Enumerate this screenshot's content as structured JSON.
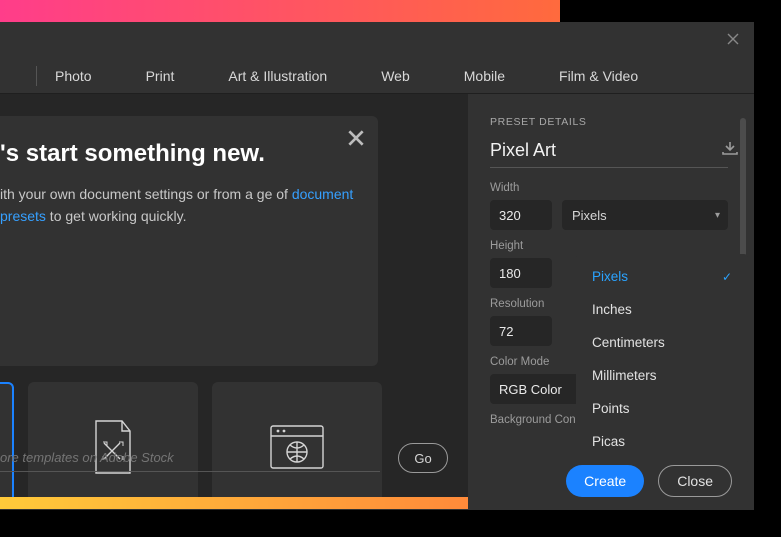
{
  "tabs": [
    "Photo",
    "Print",
    "Art & Illustration",
    "Web",
    "Mobile",
    "Film & Video"
  ],
  "welcome": {
    "title": "'s start something new.",
    "body_pre": "ith your own document settings or from a ge of ",
    "link": "document presets",
    "body_post": " to get working quickly."
  },
  "stock": {
    "placeholder": "ore templates on Adobe Stock",
    "go": "Go"
  },
  "side": {
    "header": "PRESET DETAILS",
    "preset_name": "Pixel Art",
    "labels": {
      "width": "Width",
      "height": "Height",
      "resolution": "Resolution",
      "color_mode": "Color Mode",
      "bg": "Background Con"
    },
    "values": {
      "width": "320",
      "height": "180",
      "resolution": "72",
      "color_mode": "RGB Color"
    },
    "unit_selected": "Pixels",
    "unit_options": [
      "Pixels",
      "Inches",
      "Centimeters",
      "Millimeters",
      "Points",
      "Picas"
    ]
  },
  "buttons": {
    "create": "Create",
    "close": "Close"
  }
}
